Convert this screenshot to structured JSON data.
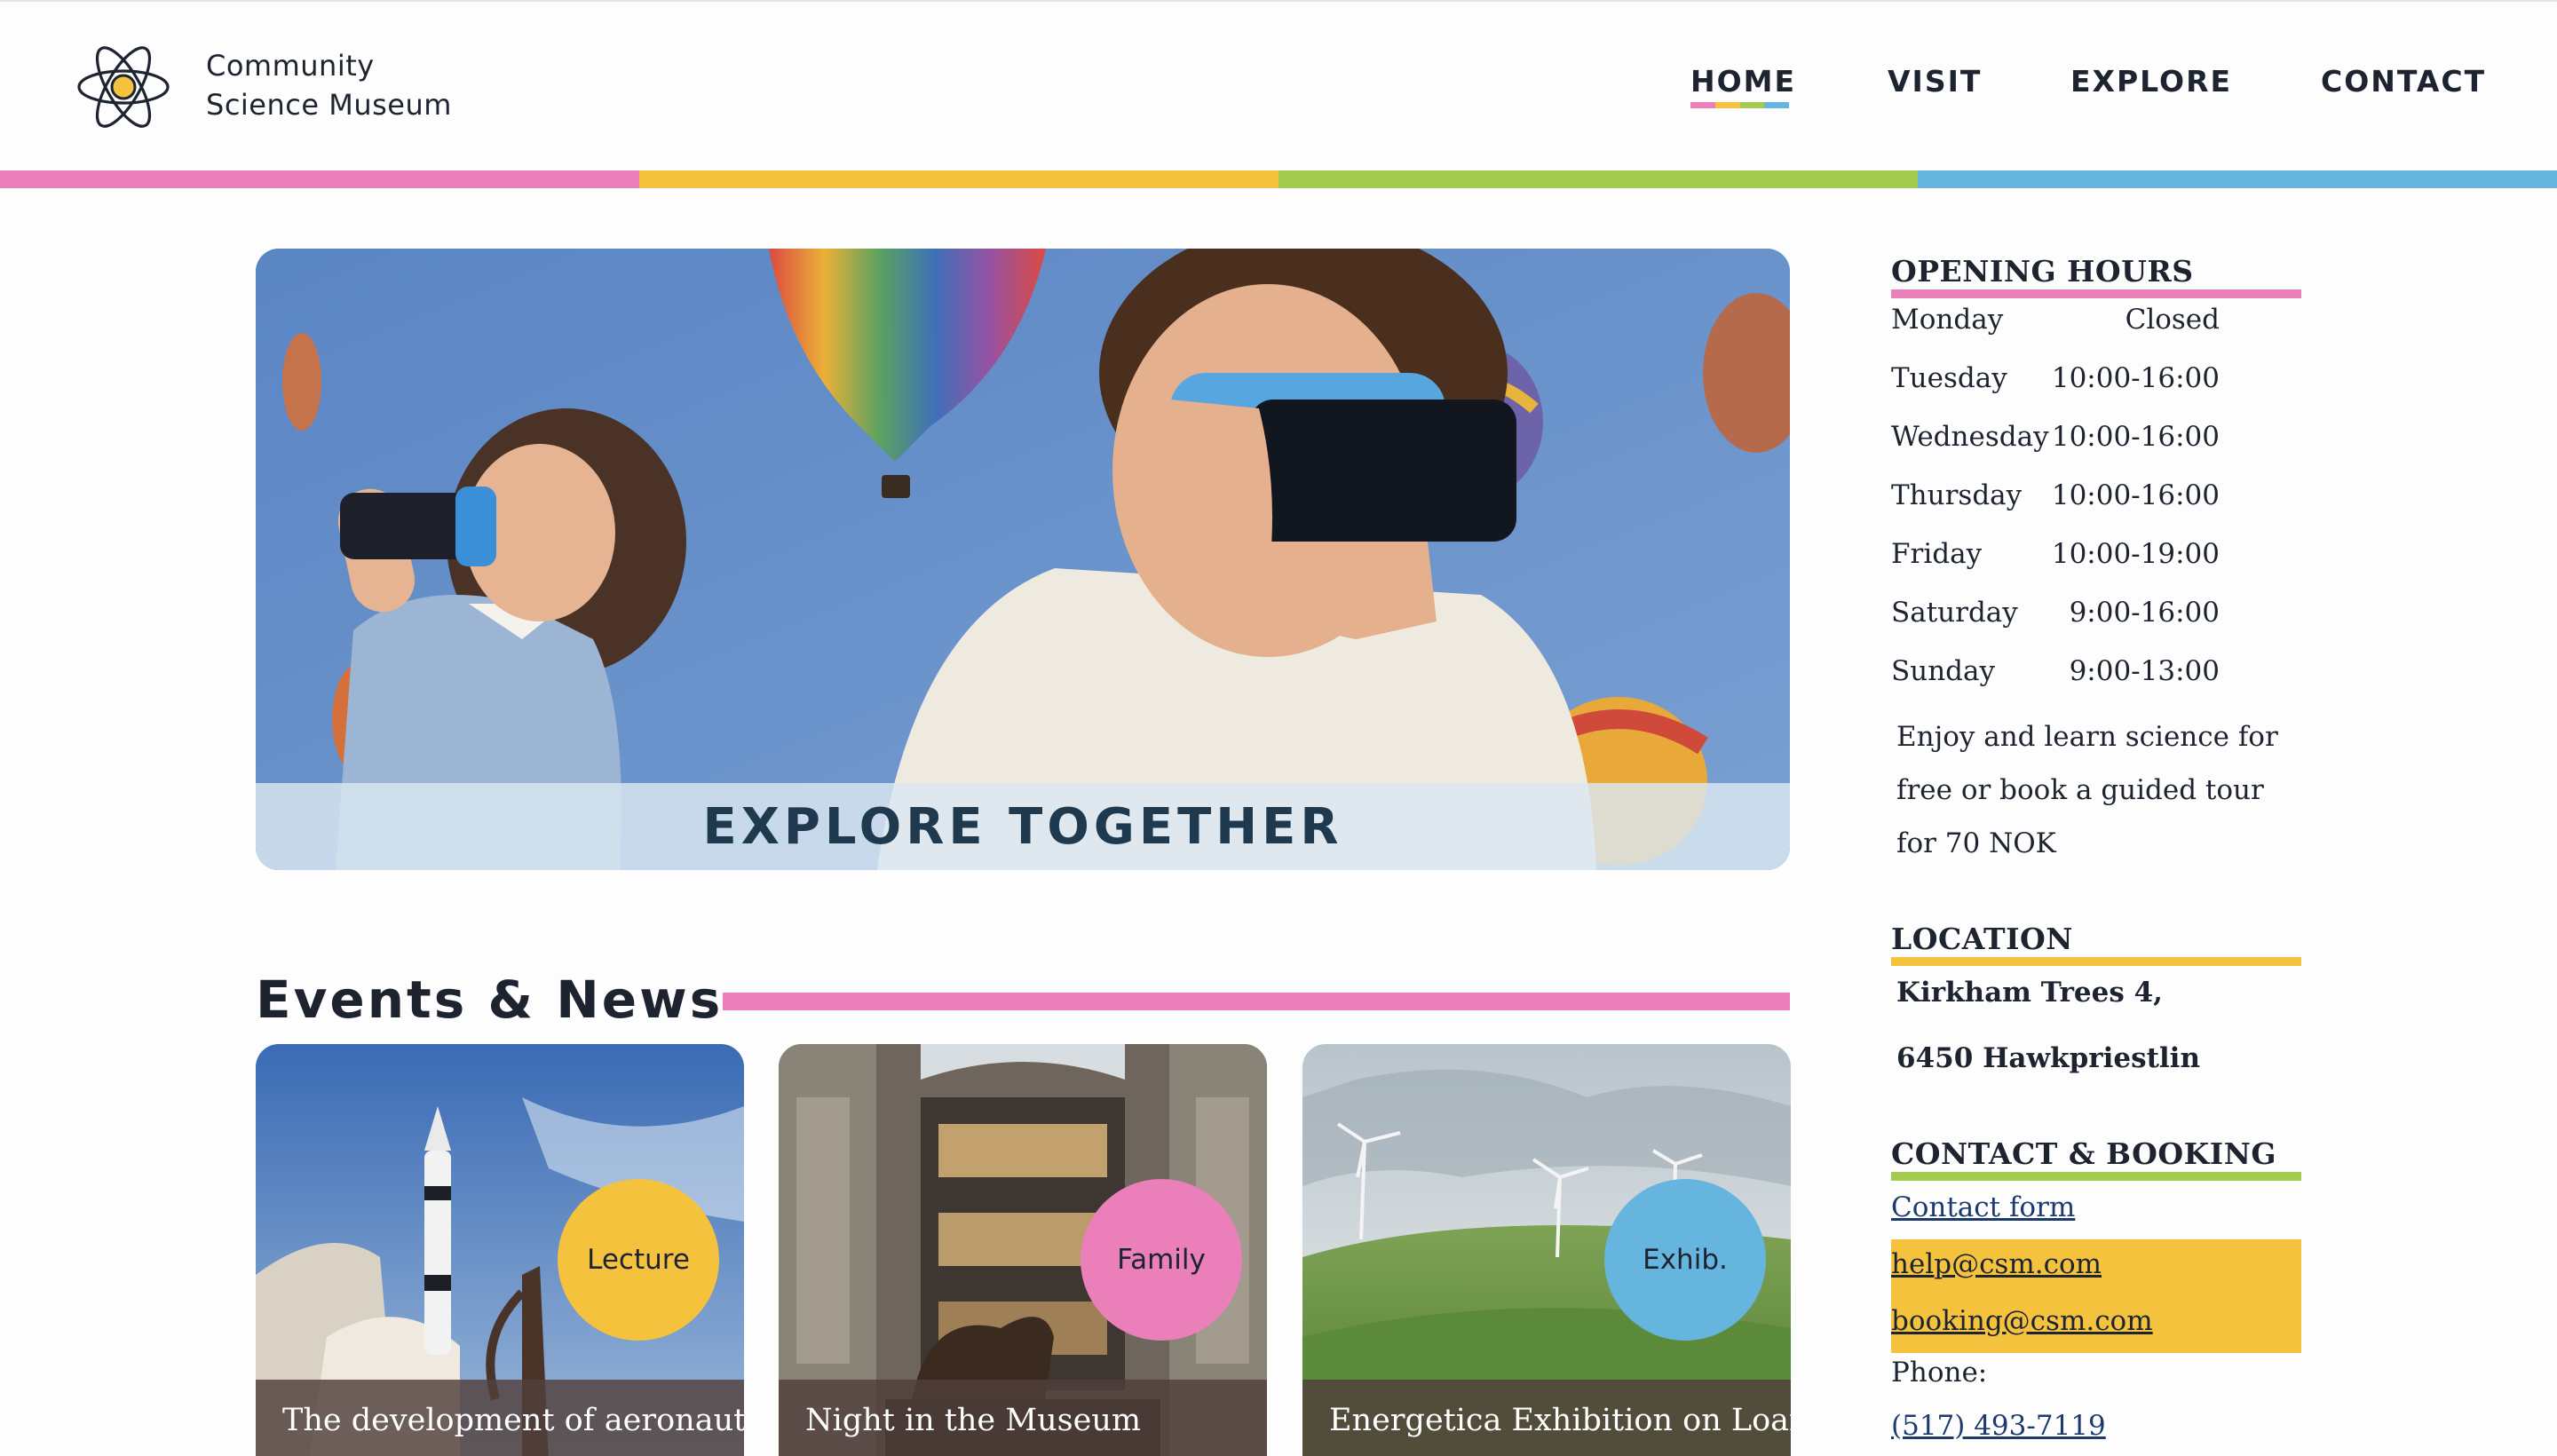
{
  "header": {
    "brand_line1": "Community",
    "brand_line2": "Science Museum",
    "logo_icon": "atom-icon"
  },
  "nav": {
    "items": [
      {
        "label": "HOME",
        "active": true
      },
      {
        "label": "VISIT",
        "active": false
      },
      {
        "label": "EXPLORE",
        "active": false
      },
      {
        "label": "CONTACT",
        "active": false
      }
    ]
  },
  "colors": {
    "pink": "#ea7fba",
    "yellow": "#f5c23e",
    "green": "#a3cc4f",
    "blue": "#65b5de",
    "dark": "#1d2430"
  },
  "hero": {
    "caption": "EXPLORE TOGETHER",
    "image": "children-with-vr-headsets-and-hot-air-balloons"
  },
  "events": {
    "title": "Events & News",
    "cards": [
      {
        "badge": "Lecture",
        "badge_color": "#f5c23e",
        "caption": "The development of aeronautics",
        "image": "rocket-launch"
      },
      {
        "badge": "Family",
        "badge_color": "#ea7fba",
        "caption": "Night in the Museum",
        "image": "museum-hall-with-mammoth"
      },
      {
        "badge": "Exhib.",
        "badge_color": "#65b5de",
        "caption": "Energetica Exhibition on Loan",
        "image": "wind-turbines-on-hills"
      }
    ]
  },
  "sidebar": {
    "hours": {
      "title": "OPENING HOURS",
      "rows": [
        {
          "day": "Monday",
          "time": "Closed"
        },
        {
          "day": "Tuesday",
          "time": "10:00-16:00"
        },
        {
          "day": "Wednesday",
          "time": "10:00-16:00"
        },
        {
          "day": "Thursday",
          "time": "10:00-16:00"
        },
        {
          "day": "Friday",
          "time": "10:00-19:00"
        },
        {
          "day": "Saturday",
          "time": "9:00-16:00"
        },
        {
          "day": "Sunday",
          "time": "9:00-13:00"
        }
      ],
      "note": "Enjoy and learn science for free or book a guided tour for 70 NOK"
    },
    "location": {
      "title": "LOCATION",
      "line1": "Kirkham Trees 4,",
      "line2": "6450 Hawkpriestlin"
    },
    "contact": {
      "title": "CONTACT & BOOKING",
      "form_link": "Contact form",
      "help_email": "help@csm.com",
      "booking_email": "booking@csm.com",
      "phone_label": "Phone:",
      "phone": "(517) 493-7119"
    }
  }
}
